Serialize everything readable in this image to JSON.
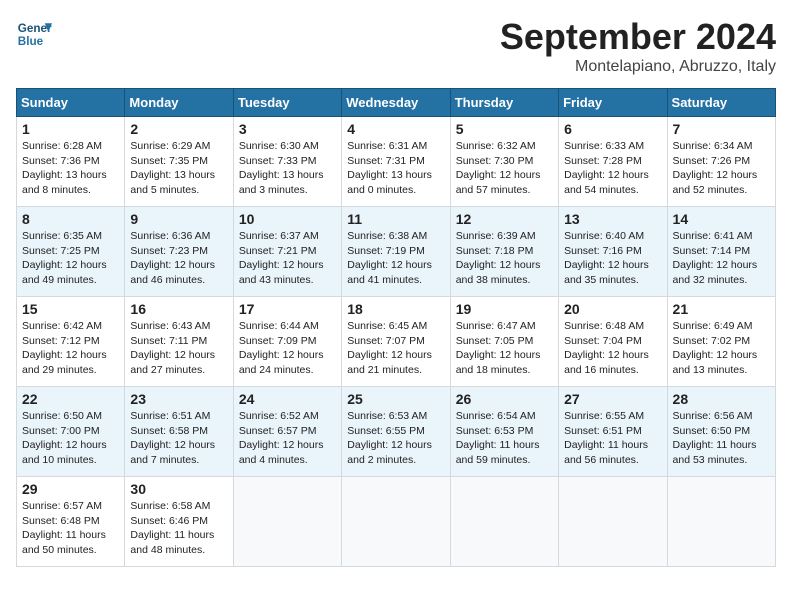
{
  "header": {
    "logo_line1": "General",
    "logo_line2": "Blue",
    "month_year": "September 2024",
    "location": "Montelapiano, Abruzzo, Italy"
  },
  "days_of_week": [
    "Sunday",
    "Monday",
    "Tuesday",
    "Wednesday",
    "Thursday",
    "Friday",
    "Saturday"
  ],
  "weeks": [
    [
      {
        "day": "1",
        "info": "Sunrise: 6:28 AM\nSunset: 7:36 PM\nDaylight: 13 hours\nand 8 minutes."
      },
      {
        "day": "2",
        "info": "Sunrise: 6:29 AM\nSunset: 7:35 PM\nDaylight: 13 hours\nand 5 minutes."
      },
      {
        "day": "3",
        "info": "Sunrise: 6:30 AM\nSunset: 7:33 PM\nDaylight: 13 hours\nand 3 minutes."
      },
      {
        "day": "4",
        "info": "Sunrise: 6:31 AM\nSunset: 7:31 PM\nDaylight: 13 hours\nand 0 minutes."
      },
      {
        "day": "5",
        "info": "Sunrise: 6:32 AM\nSunset: 7:30 PM\nDaylight: 12 hours\nand 57 minutes."
      },
      {
        "day": "6",
        "info": "Sunrise: 6:33 AM\nSunset: 7:28 PM\nDaylight: 12 hours\nand 54 minutes."
      },
      {
        "day": "7",
        "info": "Sunrise: 6:34 AM\nSunset: 7:26 PM\nDaylight: 12 hours\nand 52 minutes."
      }
    ],
    [
      {
        "day": "8",
        "info": "Sunrise: 6:35 AM\nSunset: 7:25 PM\nDaylight: 12 hours\nand 49 minutes."
      },
      {
        "day": "9",
        "info": "Sunrise: 6:36 AM\nSunset: 7:23 PM\nDaylight: 12 hours\nand 46 minutes."
      },
      {
        "day": "10",
        "info": "Sunrise: 6:37 AM\nSunset: 7:21 PM\nDaylight: 12 hours\nand 43 minutes."
      },
      {
        "day": "11",
        "info": "Sunrise: 6:38 AM\nSunset: 7:19 PM\nDaylight: 12 hours\nand 41 minutes."
      },
      {
        "day": "12",
        "info": "Sunrise: 6:39 AM\nSunset: 7:18 PM\nDaylight: 12 hours\nand 38 minutes."
      },
      {
        "day": "13",
        "info": "Sunrise: 6:40 AM\nSunset: 7:16 PM\nDaylight: 12 hours\nand 35 minutes."
      },
      {
        "day": "14",
        "info": "Sunrise: 6:41 AM\nSunset: 7:14 PM\nDaylight: 12 hours\nand 32 minutes."
      }
    ],
    [
      {
        "day": "15",
        "info": "Sunrise: 6:42 AM\nSunset: 7:12 PM\nDaylight: 12 hours\nand 29 minutes."
      },
      {
        "day": "16",
        "info": "Sunrise: 6:43 AM\nSunset: 7:11 PM\nDaylight: 12 hours\nand 27 minutes."
      },
      {
        "day": "17",
        "info": "Sunrise: 6:44 AM\nSunset: 7:09 PM\nDaylight: 12 hours\nand 24 minutes."
      },
      {
        "day": "18",
        "info": "Sunrise: 6:45 AM\nSunset: 7:07 PM\nDaylight: 12 hours\nand 21 minutes."
      },
      {
        "day": "19",
        "info": "Sunrise: 6:47 AM\nSunset: 7:05 PM\nDaylight: 12 hours\nand 18 minutes."
      },
      {
        "day": "20",
        "info": "Sunrise: 6:48 AM\nSunset: 7:04 PM\nDaylight: 12 hours\nand 16 minutes."
      },
      {
        "day": "21",
        "info": "Sunrise: 6:49 AM\nSunset: 7:02 PM\nDaylight: 12 hours\nand 13 minutes."
      }
    ],
    [
      {
        "day": "22",
        "info": "Sunrise: 6:50 AM\nSunset: 7:00 PM\nDaylight: 12 hours\nand 10 minutes."
      },
      {
        "day": "23",
        "info": "Sunrise: 6:51 AM\nSunset: 6:58 PM\nDaylight: 12 hours\nand 7 minutes."
      },
      {
        "day": "24",
        "info": "Sunrise: 6:52 AM\nSunset: 6:57 PM\nDaylight: 12 hours\nand 4 minutes."
      },
      {
        "day": "25",
        "info": "Sunrise: 6:53 AM\nSunset: 6:55 PM\nDaylight: 12 hours\nand 2 minutes."
      },
      {
        "day": "26",
        "info": "Sunrise: 6:54 AM\nSunset: 6:53 PM\nDaylight: 11 hours\nand 59 minutes."
      },
      {
        "day": "27",
        "info": "Sunrise: 6:55 AM\nSunset: 6:51 PM\nDaylight: 11 hours\nand 56 minutes."
      },
      {
        "day": "28",
        "info": "Sunrise: 6:56 AM\nSunset: 6:50 PM\nDaylight: 11 hours\nand 53 minutes."
      }
    ],
    [
      {
        "day": "29",
        "info": "Sunrise: 6:57 AM\nSunset: 6:48 PM\nDaylight: 11 hours\nand 50 minutes."
      },
      {
        "day": "30",
        "info": "Sunrise: 6:58 AM\nSunset: 6:46 PM\nDaylight: 11 hours\nand 48 minutes."
      },
      {
        "day": "",
        "info": ""
      },
      {
        "day": "",
        "info": ""
      },
      {
        "day": "",
        "info": ""
      },
      {
        "day": "",
        "info": ""
      },
      {
        "day": "",
        "info": ""
      }
    ]
  ]
}
